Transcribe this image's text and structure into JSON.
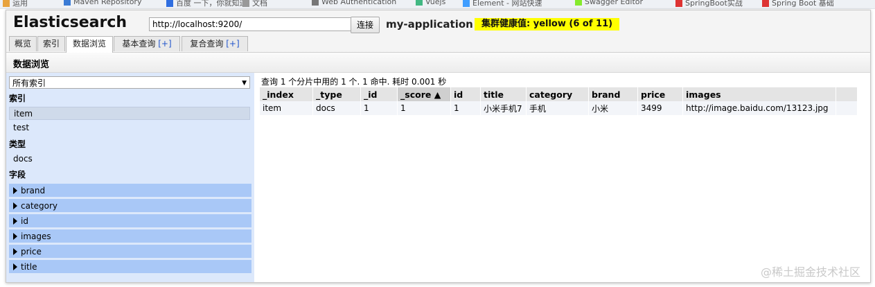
{
  "bookmarks": [
    "运用",
    "Maven Repository",
    "百度 一下，你就知道",
    "文档",
    "Web Authentication",
    "Vuejs",
    "Element - 网站快速",
    "Swagger Editor",
    "SpringBoot实战",
    "Spring Boot 基础"
  ],
  "header": {
    "brand": "Elasticsearch",
    "url_value": "http://localhost:9200/",
    "connect_label": "连接",
    "cluster_name": "my-application",
    "health": "集群健康值: yellow (6 of 11)",
    "health_color": "#ffff00"
  },
  "tabs": [
    {
      "label": "概览",
      "plus": ""
    },
    {
      "label": "索引",
      "plus": ""
    },
    {
      "label": "数据浏览",
      "plus": ""
    },
    {
      "label": "基本查询 ",
      "plus": "[+]"
    },
    {
      "label": "复合查询 ",
      "plus": "[+]"
    }
  ],
  "section_title": "数据浏览",
  "sidebar": {
    "index_select": "所有索引",
    "indices_heading": "索引",
    "indices": [
      "item",
      "test"
    ],
    "types_heading": "类型",
    "types": [
      "docs"
    ],
    "fields_heading": "字段",
    "fields": [
      "brand",
      "category",
      "id",
      "images",
      "price",
      "title"
    ]
  },
  "results": {
    "summary": "查询 1 个分片中用的 1 个. 1 命中. 耗时 0.001 秒",
    "sort_indicator": "▲",
    "columns": [
      "_index",
      "_type",
      "_id",
      "_score",
      "id",
      "title",
      "category",
      "brand",
      "price",
      "images"
    ],
    "rows": [
      [
        "item",
        "docs",
        "1",
        "1",
        "1",
        "小米手机7",
        "手机",
        "小米",
        "3499",
        "http://image.baidu.com/13123.jpg"
      ]
    ]
  },
  "watermark": "@稀土掘金技术社区"
}
